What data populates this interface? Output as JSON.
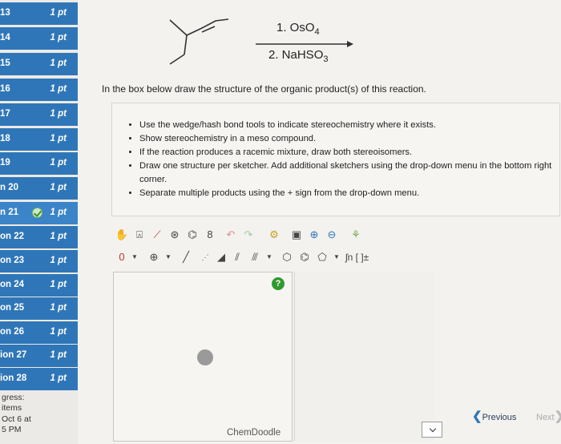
{
  "sidebar": {
    "questions": [
      {
        "num": "13",
        "points": "1 pt"
      },
      {
        "num": "14",
        "points": "1 pt"
      },
      {
        "num": "15",
        "points": "1 pt"
      },
      {
        "num": "16",
        "points": "1 pt"
      },
      {
        "num": "17",
        "points": "1 pt"
      },
      {
        "num": "18",
        "points": "1 pt"
      },
      {
        "num": "19",
        "points": "1 pt"
      },
      {
        "num": "n 20",
        "points": "1 pt"
      },
      {
        "num": "n 21",
        "points": "1 pt"
      },
      {
        "num": "on 22",
        "points": "1 pt"
      },
      {
        "num": "on 23",
        "points": "1 pt"
      },
      {
        "num": "on 24",
        "points": "1 pt"
      },
      {
        "num": "on 25",
        "points": "1 pt"
      },
      {
        "num": "on 26",
        "points": "1 pt"
      },
      {
        "num": "ion 27",
        "points": "1 pt"
      },
      {
        "num": "ion 28",
        "points": "1 pt"
      }
    ],
    "progress_label": "gress:",
    "progress_items": "items",
    "due_date": "Oct 6 at",
    "due_time": "5 PM"
  },
  "reaction": {
    "reagent1": "1. OsO",
    "reagent1_sub": "4",
    "reagent2": "2. NaHSO",
    "reagent2_sub": "3"
  },
  "prompt": "In the box below draw the structure of the organic product(s) of this reaction.",
  "instructions": [
    "Use the wedge/hash bond tools to indicate stereochemistry where it exists.",
    "Show stereochemistry in a meso compound.",
    "If the reaction produces a racemic mixture, draw both stereoisomers.",
    "Draw one structure per sketcher. Add additional sketchers using the drop-down menu in the bottom right corner.",
    "Separate multiple products using the + sign from the drop-down menu."
  ],
  "sketcher": {
    "charge_label": "0",
    "plus_label": "⊕",
    "template_label": "ʃn [ ]±",
    "help_label": "?",
    "brand": "ChemDoodle"
  },
  "nav": {
    "previous": "Previous",
    "next": "Next"
  },
  "colors": {
    "nav_blue": "#2f76b8",
    "check_green": "#2f9a2f"
  }
}
